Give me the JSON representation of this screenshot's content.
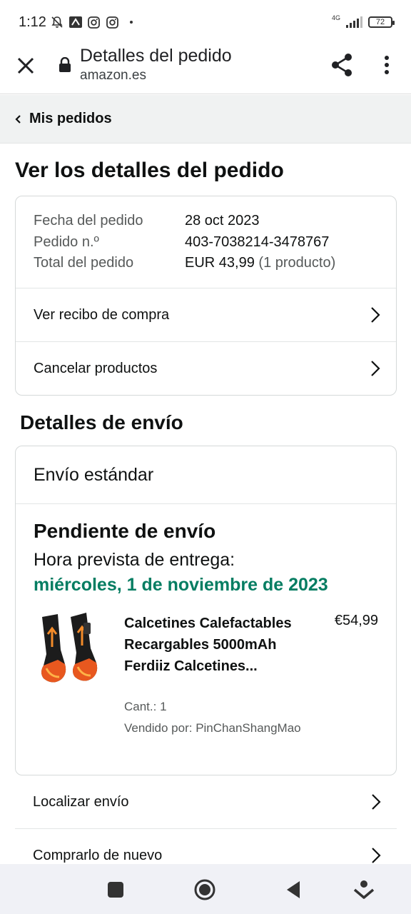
{
  "status_bar": {
    "time": "1:12",
    "network": "4G",
    "battery": "72"
  },
  "browser": {
    "title": "Detalles del pedido",
    "domain": "amazon.es"
  },
  "breadcrumb": {
    "label": "Mis pedidos"
  },
  "order": {
    "heading": "Ver los detalles del pedido",
    "date_label": "Fecha del pedido",
    "date_value": "28 oct 2023",
    "number_label": "Pedido n.º",
    "number_value": "403-7038214-3478767",
    "total_label": "Total del pedido",
    "total_value": "EUR 43,99",
    "total_count": "(1 producto)",
    "links": [
      {
        "label": "Ver recibo de compra"
      },
      {
        "label": "Cancelar productos"
      }
    ]
  },
  "shipping": {
    "heading": "Detalles de envío",
    "method": "Envío estándar",
    "status": "Pendiente de envío",
    "eta_label": "Hora prevista de entrega:",
    "eta_date": "miércoles, 1 de noviembre de 2023",
    "eta_color": "#067d62",
    "product": {
      "name": "Calcetines Calefactables Recargables 5000mAh Ferdiiz Calcetines...",
      "price": "€54,99",
      "quantity": "Cant.: 1",
      "seller": "Vendido por: PinChanShangMao"
    },
    "actions": [
      {
        "label": "Localizar envío"
      },
      {
        "label": "Comprarlo de nuevo"
      }
    ]
  },
  "icons": [
    "close-icon",
    "lock-icon",
    "share-icon",
    "more-vert-icon",
    "chevron-left-icon",
    "chevron-right-icon",
    "nav-square-icon",
    "nav-home-icon",
    "nav-back-icon",
    "nav-assist-icon"
  ]
}
